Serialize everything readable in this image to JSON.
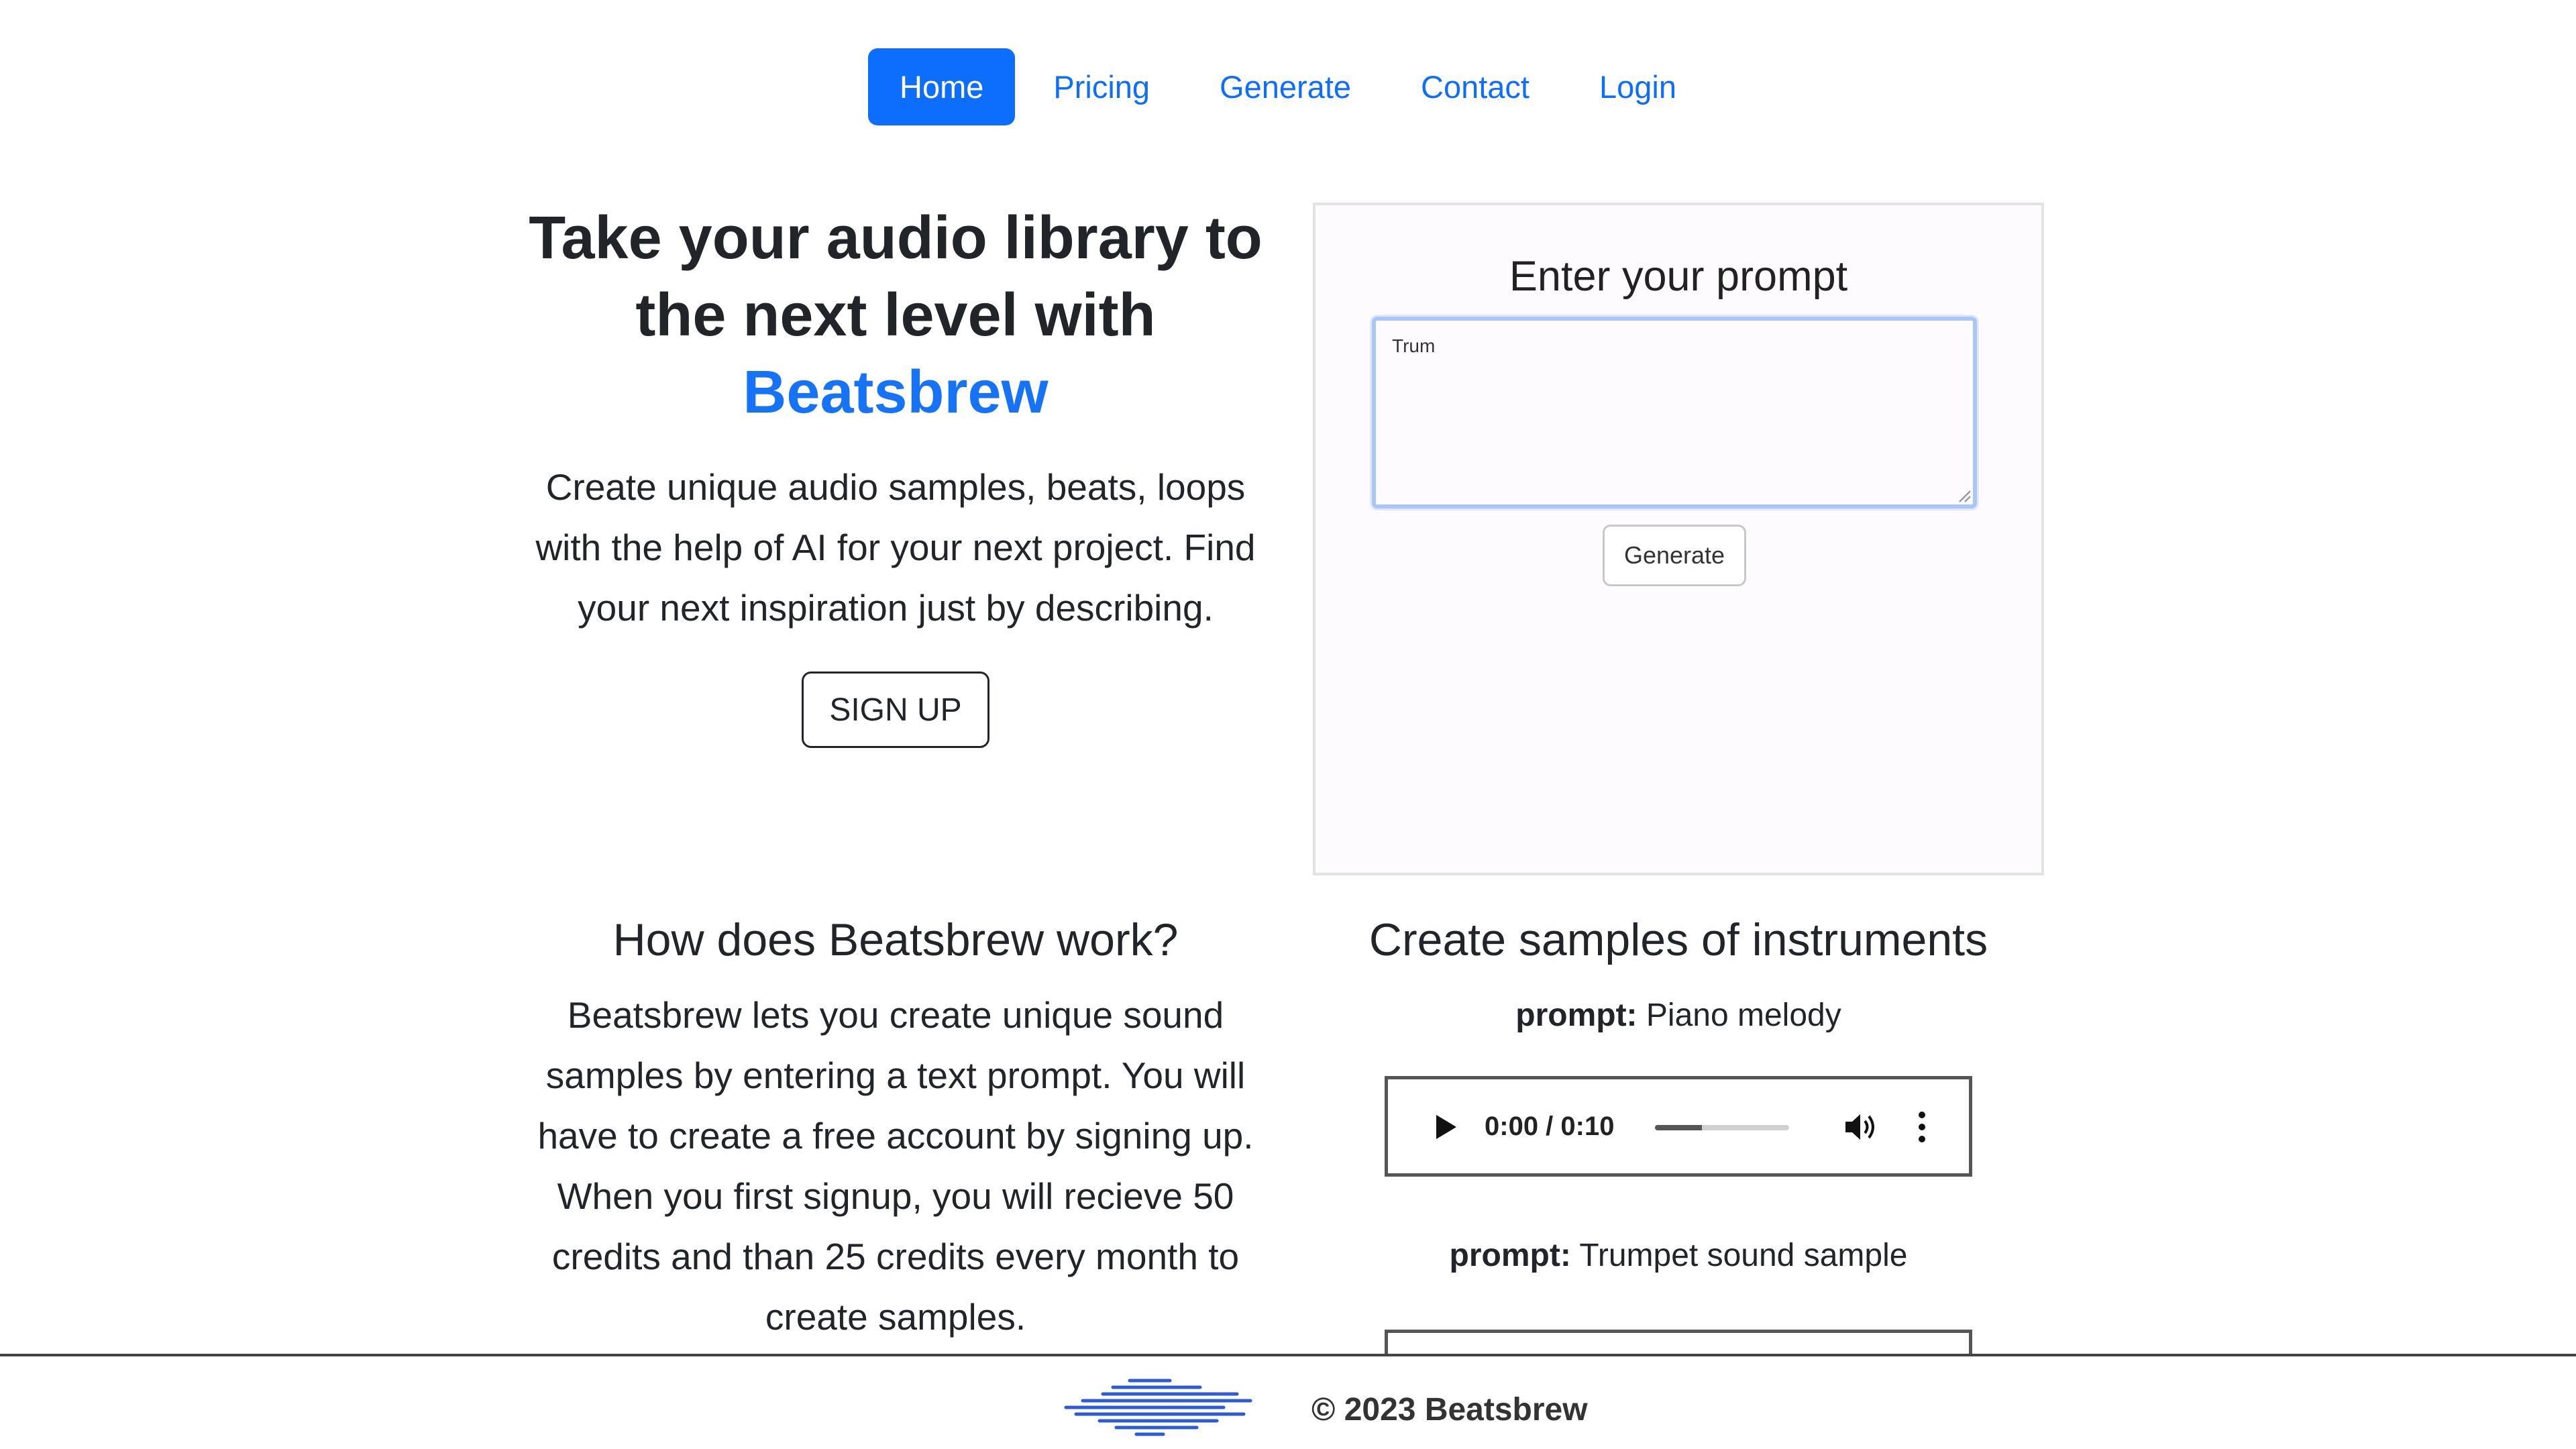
{
  "nav": {
    "items": [
      {
        "label": "Home",
        "active": true
      },
      {
        "label": "Pricing",
        "active": false
      },
      {
        "label": "Generate",
        "active": false
      },
      {
        "label": "Contact",
        "active": false
      },
      {
        "label": "Login",
        "active": false
      }
    ]
  },
  "hero": {
    "title_line": "Take your audio library to the next level with",
    "brand": "Beatsbrew",
    "description": "Create unique audio samples, beats, loops with the help of AI for your next project. Find your next inspiration just by describing.",
    "signup_label": "SIGN UP"
  },
  "prompt_card": {
    "heading": "Enter your prompt",
    "input_value": "Trum",
    "generate_label": "Generate"
  },
  "how": {
    "title": "How does Beatsbrew work?",
    "description": "Beatsbrew lets you create unique sound samples by entering a text prompt. You will have to create a free account by signing up. When you first signup, you will recieve 50 credits and than 25 credits every month to create samples."
  },
  "samples": {
    "title": "Create samples of instruments",
    "prompt_label": "prompt:",
    "items": [
      {
        "prompt": "Piano melody",
        "time": "0:00 / 0:10",
        "volume_level": 0.35
      },
      {
        "prompt": "Trumpet sound sample"
      }
    ]
  },
  "footer": {
    "copyright": "© 2023 Beatsbrew"
  },
  "colors": {
    "accent": "#0d6efd",
    "brand": "#1673f6",
    "logo_wave": "#2d5bd8"
  },
  "icons": [
    "play-icon",
    "volume-icon",
    "more-vertical-icon",
    "logo-wave-icon",
    "resize-grip-icon"
  ]
}
